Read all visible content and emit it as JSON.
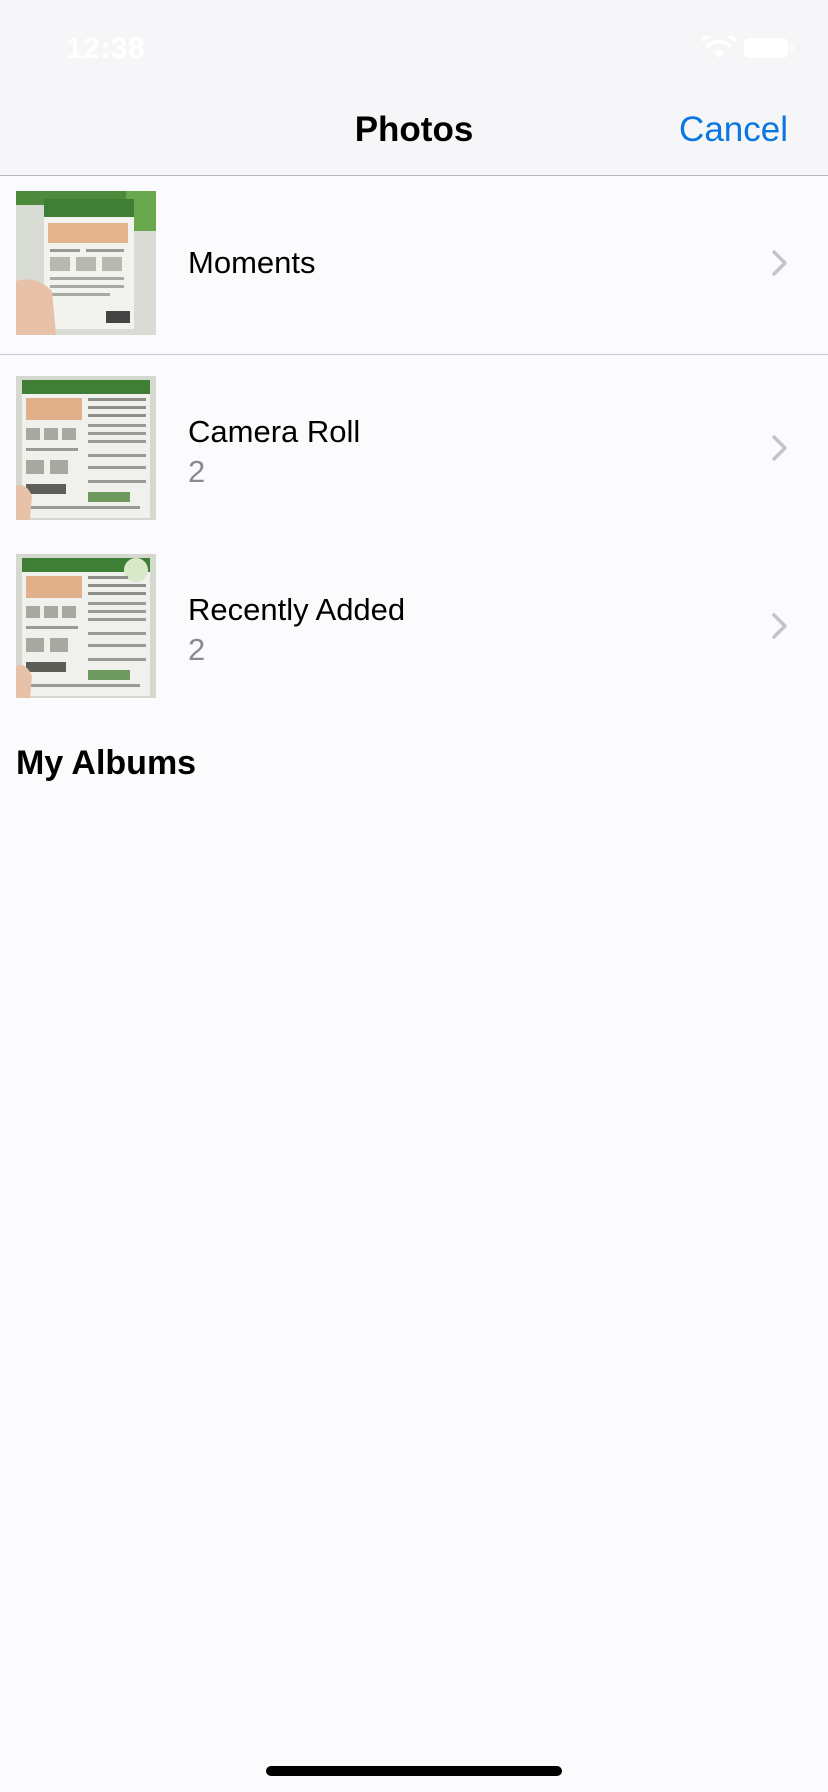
{
  "status_bar": {
    "time": "12:38"
  },
  "nav": {
    "title": "Photos",
    "cancel_label": "Cancel"
  },
  "albums": [
    {
      "title": "Moments",
      "count": "",
      "thumbnail": "photo of a product package held in hand"
    },
    {
      "title": "Camera Roll",
      "count": "2",
      "thumbnail": "photo of a product package back label"
    },
    {
      "title": "Recently Added",
      "count": "2",
      "thumbnail": "photo of a product package back label"
    }
  ],
  "section": {
    "my_albums_label": "My Albums"
  },
  "colors": {
    "accent": "#0a78e0",
    "background": "#fbfbfe",
    "nav_background": "#f6f6f8",
    "secondary_text": "#8a8a8e",
    "chevron": "#c4c4c7"
  },
  "icons": {
    "row_disclosure": "chevron-right-icon",
    "status_wifi": "wifi-icon",
    "status_battery": "battery-icon"
  }
}
